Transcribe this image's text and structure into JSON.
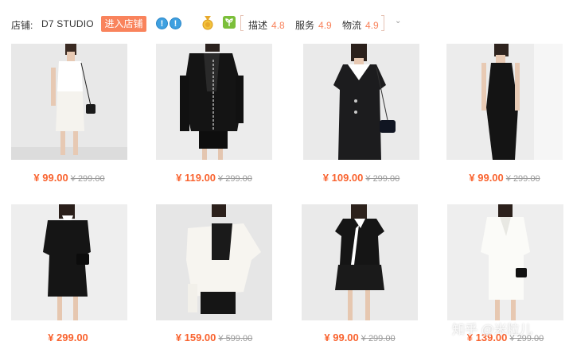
{
  "header": {
    "shop_label": "店铺:",
    "shop_name": "D7 STUDIO",
    "enter_button": "进入店铺",
    "badges": [
      "!",
      "!"
    ],
    "ratings": [
      {
        "label": "描述",
        "value": "4.8"
      },
      {
        "label": "服务",
        "value": "4.9"
      },
      {
        "label": "物流",
        "value": "4.9"
      }
    ],
    "chevron": "⌄"
  },
  "products": [
    {
      "price": "¥ 99.00",
      "original": "¥ 299.00",
      "dress": "white-slip-dress"
    },
    {
      "price": "¥ 119.00",
      "original": "¥ 299.00",
      "dress": "black-blazer-set"
    },
    {
      "price": "¥ 109.00",
      "original": "¥ 299.00",
      "dress": "black-collar-dress"
    },
    {
      "price": "¥ 99.00",
      "original": "¥ 299.00",
      "dress": "black-slip-dress"
    },
    {
      "price": "¥ 299.00",
      "original": "",
      "dress": "black-shirt-dress"
    },
    {
      "price": "¥ 159.00",
      "original": "¥ 599.00",
      "dress": "white-shirt-black-skirt"
    },
    {
      "price": "¥ 99.00",
      "original": "¥ 299.00",
      "dress": "black-polo-dress"
    },
    {
      "price": "¥ 139.00",
      "original": "¥ 299.00",
      "dress": "white-shirt-dress"
    }
  ],
  "watermark": "知乎 @米粒儿",
  "colors": {
    "accent": "#f9835c",
    "price": "#f9632f",
    "photo_bg": "#e9e9e9"
  }
}
